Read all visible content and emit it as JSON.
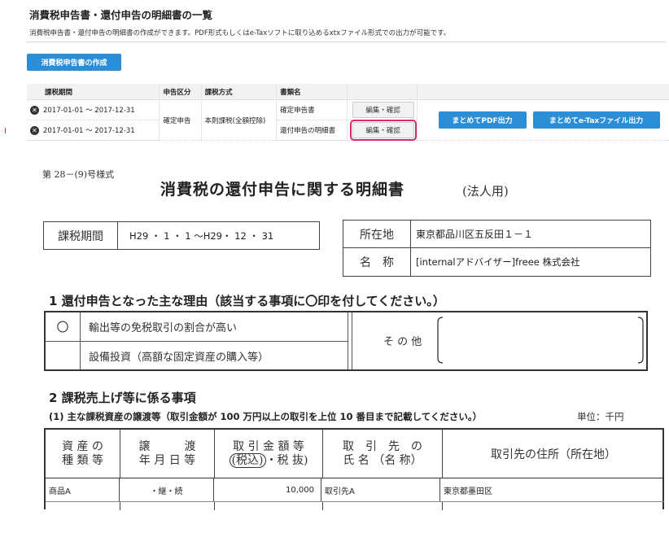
{
  "header": {
    "title": "消費税申告書・還付申告の明細書の一覧",
    "description": "消費税申告書・還付申告の明細書の作成ができます。PDF形式もしくはe-Taxソフトに取り込めるxtxファイル形式での出力が可能です。"
  },
  "toolbar": {
    "create_label": "消費税申告書の作成"
  },
  "table": {
    "headers": [
      "課税期間",
      "申告区分",
      "課税方式",
      "書類名"
    ],
    "rows": [
      {
        "period": "2017-01-01 〜 2017-12-31",
        "doc_name": "確定申告書",
        "action": "編集・確認"
      },
      {
        "period": "2017-01-01 〜 2017-12-31",
        "doc_name": "還付申告の明細書",
        "action": "編集・確認"
      }
    ],
    "shared": {
      "filing_type": "確定申告",
      "tax_method": "本則課税(全額控除)"
    },
    "export_pdf_label": "まとめてPDF出力",
    "export_etax_label": "まとめてe-Taxファイル出力"
  },
  "form": {
    "code": "第 28－(9)号様式",
    "title": "消費税の還付申告に関する明細書",
    "title_suffix": "(法人用)",
    "period_label": "課税期間",
    "period_value": "H29 ・ 1 ・ 1 〜H29・ 12 ・ 31",
    "address_label": "所在地",
    "address_value": "東京都品川区五反田１－１",
    "name_label": "名　称",
    "name_value": "[internalアドバイザー]freee 株式会社",
    "section1_title": "1 還付申告となった主な理由（該当する事項に〇印を付してください。）",
    "reason_mark": "〇",
    "reason_1": "輸出等の免税取引の割合が高い",
    "reason_2": "設備投資（高額な固定資産の購入等）",
    "other_label": "そ の 他",
    "section2_title": "2 課税売上げ等に係る事項",
    "section2_sub": "(1) 主な課税資産の譲渡等（取引金額が 100 万円以上の取引を上位 10 番目まで記載してください。）",
    "unit": "単位：千円",
    "cols": {
      "c1a": "資 産 の",
      "c1b": "種 類 等",
      "c2a": "譲　　　渡",
      "c2b": "年 月 日 等",
      "c3a": "取 引 金 額 等",
      "c3b_a": "(税込)",
      "c3b_b": "・税 抜)",
      "c4a": "取　引　先　の",
      "c4b": "氏 名 （名 称）",
      "c5": "取引先の住所（所在地）"
    },
    "row": {
      "asset": "商品A",
      "date": "・継・続",
      "amount": "10,000",
      "partner": "取引先A",
      "partner_address": "東京都墨田区"
    }
  }
}
